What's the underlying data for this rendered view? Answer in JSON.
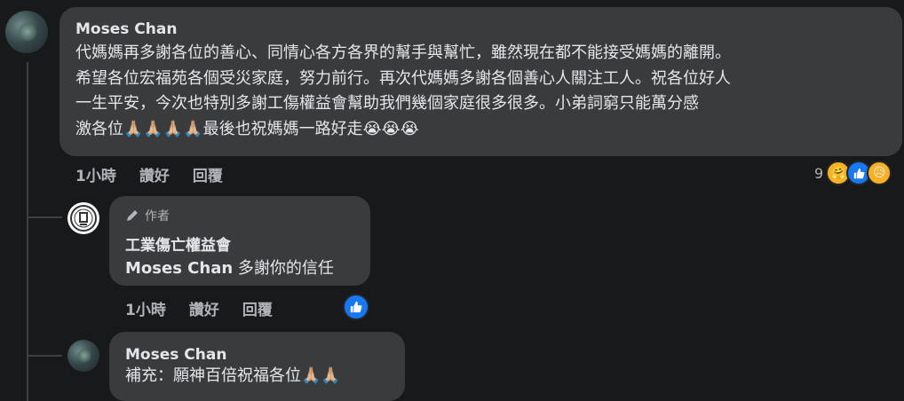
{
  "comments": [
    {
      "author": "Moses Chan",
      "lines": [
        "代媽媽再多謝各位的善心、同情心各方各界的幫手與幫忙，雖然現在都不能接受媽媽的離開。",
        "希望各位宏福苑各個受災家庭，努力前行。再次代媽媽多謝各個善心人關注工人。祝各位好人",
        "一生平安，今次也特別多謝工傷￼權益會幫助我們幾個家庭很多很多￼。小弟詞窮只能萬分感",
        "激各位🙏🏼🙏🏼🙏🏼🙏🏼最後也祝媽媽一路好走😭😭😭"
      ],
      "time": "1小時",
      "like_label": "讚好",
      "reply_label": "回覆",
      "reaction_count": "9",
      "reaction_icons": [
        "care-icon",
        "like-icon",
        "sad-icon"
      ]
    },
    {
      "author_badge": "作者",
      "author": "工業傷亡權益會",
      "body_name": "Moses Chan",
      "body_text": " 多謝你的信任",
      "time": "1小時",
      "like_label": "讚好",
      "reply_label": "回覆"
    },
    {
      "author": "Moses Chan",
      "body_text": "補充：願神百倍祝福各位🙏🏼🙏🏼"
    }
  ],
  "colors": {
    "background": "#18191a",
    "bubble": "#3a3b3c",
    "like_blue": "#1877f2"
  }
}
